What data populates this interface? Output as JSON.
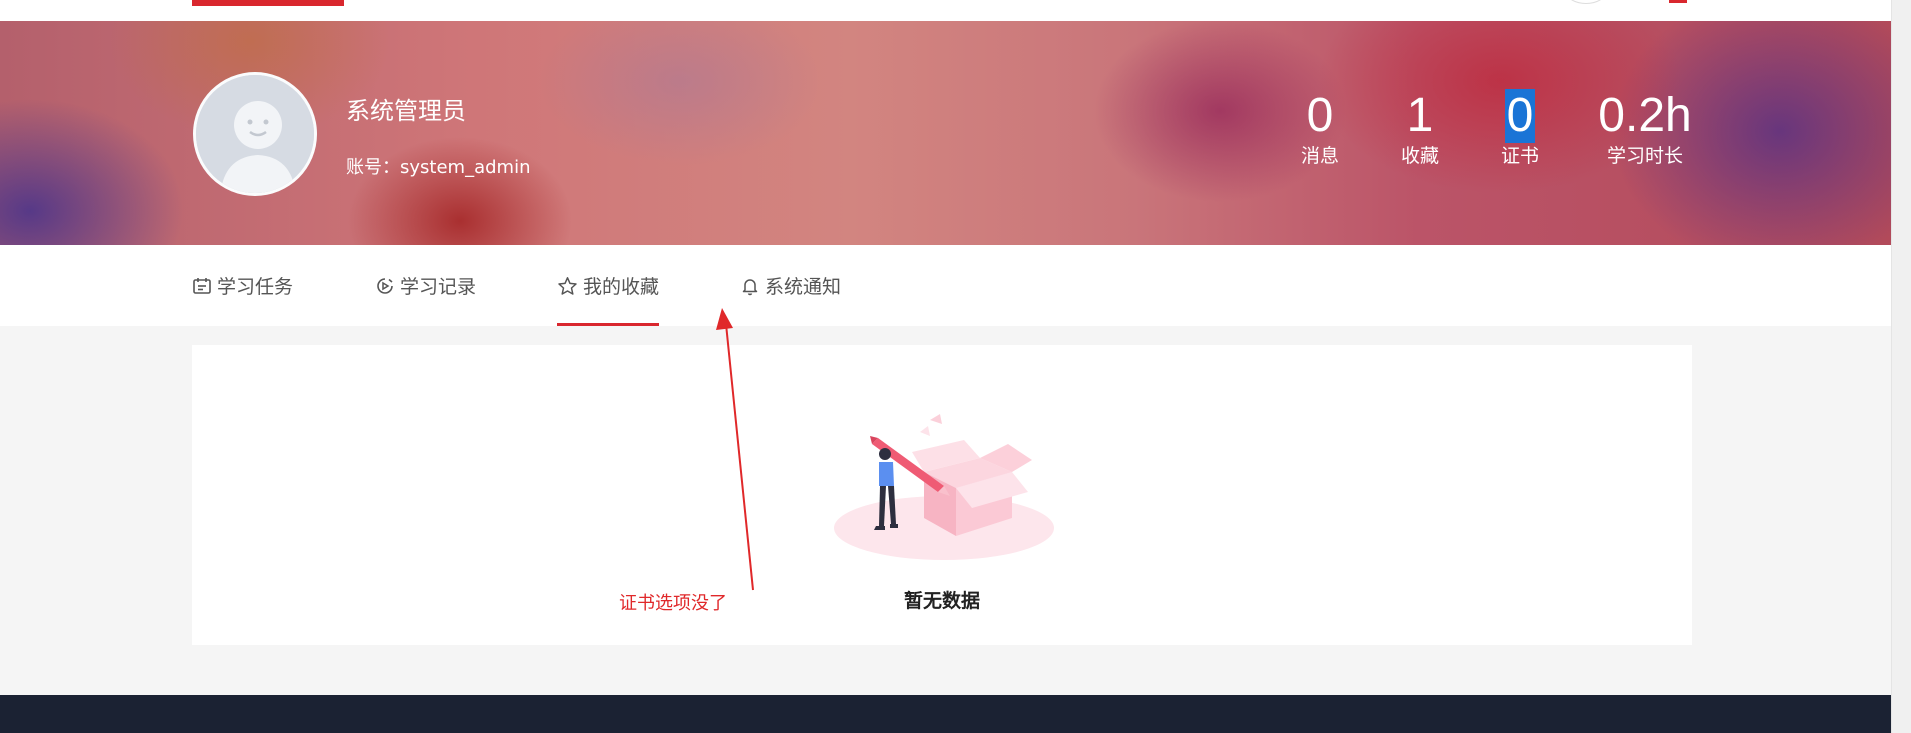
{
  "topbar": {
    "logo_text": ""
  },
  "profile": {
    "name": "系统管理员",
    "account": "账号：system_admin"
  },
  "stats": [
    {
      "value": "0",
      "label": "消息"
    },
    {
      "value": "1",
      "label": "收藏"
    },
    {
      "value": "0",
      "label": "证书"
    },
    {
      "value": "0.2h",
      "label": "学习时长"
    }
  ],
  "tabs": [
    {
      "label": "学习任务",
      "icon": "calendar-icon"
    },
    {
      "label": "学习记录",
      "icon": "play-record-icon"
    },
    {
      "label": "我的收藏",
      "icon": "star-icon",
      "active": true
    },
    {
      "label": "系统通知",
      "icon": "bell-icon"
    }
  ],
  "empty_state": {
    "text": "暂无数据"
  },
  "annotation": {
    "text": "证书选项没了"
  },
  "colors": {
    "accent": "#d9272e",
    "footer": "#1b2233",
    "selection": "#1a74d6"
  }
}
